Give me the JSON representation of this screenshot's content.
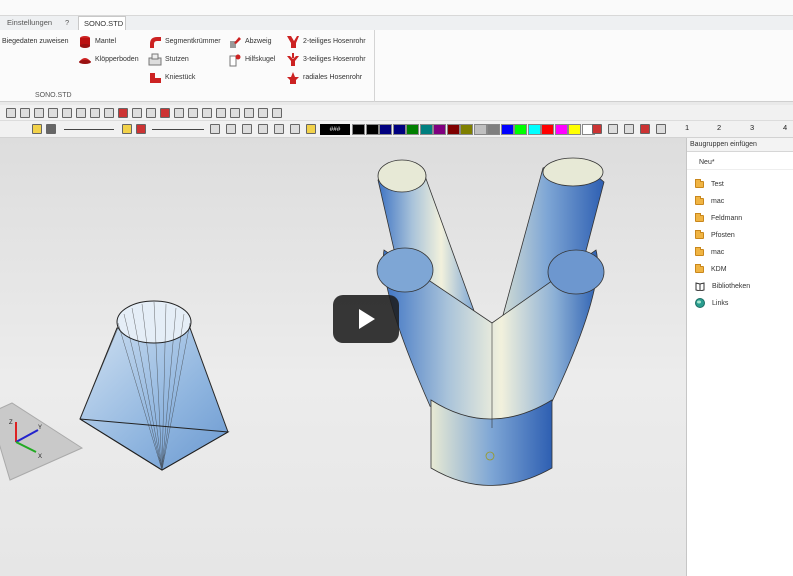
{
  "tabs": [
    {
      "label": "Einstellungen"
    },
    {
      "label": "?"
    },
    {
      "label": "SONO.STD"
    }
  ],
  "ribbon": {
    "group_label": "SONO.STD",
    "buttons": [
      {
        "label": "Biegedaten zuweisen"
      },
      {
        "label": "Mantel"
      },
      {
        "label": "Klöpperboden"
      },
      {
        "label": "Segmentkrümmer"
      },
      {
        "label": "Stutzen"
      },
      {
        "label": "Kniestück"
      },
      {
        "label": "Abzweig"
      },
      {
        "label": "Hilfskugel"
      },
      {
        "label": "2-teiliges Hosenrohr"
      },
      {
        "label": "3-teiliges Hosenrohr"
      },
      {
        "label": "radiales Hosenrohr"
      }
    ]
  },
  "toolbar": {
    "color_input": "###",
    "swatches": [
      "#000000",
      "#000000",
      "#00007f",
      "#00007f",
      "#007f00",
      "#007f7f",
      "#7f007f",
      "#7f0000",
      "#7f7f00",
      "#c0c0c0",
      "#7f7f7f",
      "#0000ff",
      "#00ff00",
      "#00ffff",
      "#ff0000",
      "#ff00ff",
      "#ffff00",
      "#ffffff"
    ],
    "pages": [
      "1",
      "2",
      "3",
      "4"
    ]
  },
  "panel": {
    "title": "Baugruppen einfügen",
    "new_label": "Neu*",
    "items": [
      {
        "label": "Test",
        "icon": "folder-icon"
      },
      {
        "label": "mac",
        "icon": "folder-icon"
      },
      {
        "label": "Feldmann",
        "icon": "folder-icon"
      },
      {
        "label": "Pfosten",
        "icon": "folder-icon"
      },
      {
        "label": "mac",
        "icon": "folder-icon"
      },
      {
        "label": "KDM",
        "icon": "folder-icon"
      },
      {
        "label": "Bibliotheken",
        "icon": "book-icon"
      },
      {
        "label": "Links",
        "icon": "globe-icon"
      }
    ]
  },
  "axes": {
    "x": "X",
    "y": "Y",
    "z": "Z"
  }
}
